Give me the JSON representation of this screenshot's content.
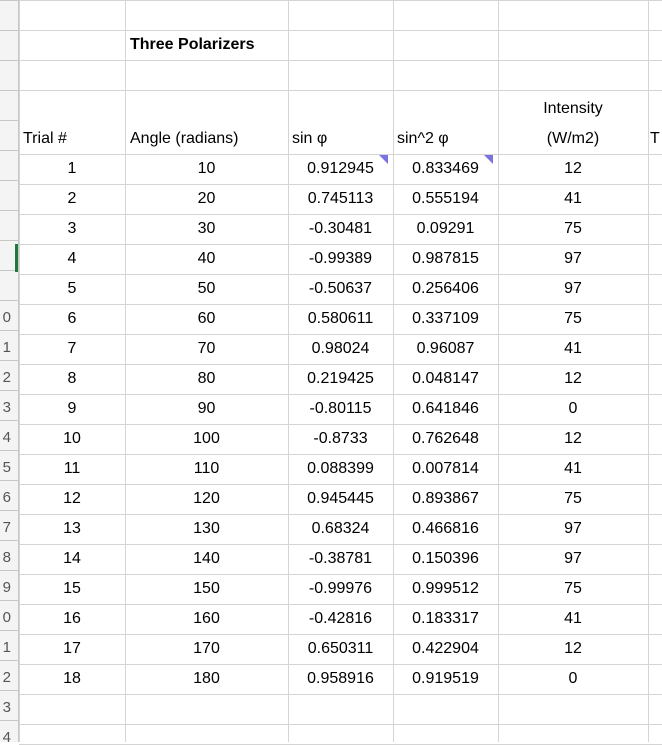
{
  "title": "Three Polarizers",
  "headers": {
    "trial": "Trial #",
    "angle": "Angle (radians)",
    "sin": "sin φ",
    "sin2": "sin^2 φ",
    "intensity_line1": "Intensity",
    "intensity_line2": "(W/m2)",
    "cut": "T"
  },
  "row_header_labels": [
    "",
    "",
    "",
    "",
    "",
    "",
    "",
    "",
    "",
    "0",
    "1",
    "2",
    "3",
    "4",
    "5",
    "6",
    "7",
    "8",
    "9",
    "0",
    "1",
    "2",
    "3",
    "4"
  ],
  "rows": [
    {
      "trial": "1",
      "angle": "10",
      "sin": "0.912945",
      "sin2": "0.833469",
      "intensity": "12"
    },
    {
      "trial": "2",
      "angle": "20",
      "sin": "0.745113",
      "sin2": "0.555194",
      "intensity": "41"
    },
    {
      "trial": "3",
      "angle": "30",
      "sin": "-0.30481",
      "sin2": "0.09291",
      "intensity": "75"
    },
    {
      "trial": "4",
      "angle": "40",
      "sin": "-0.99389",
      "sin2": "0.987815",
      "intensity": "97"
    },
    {
      "trial": "5",
      "angle": "50",
      "sin": "-0.50637",
      "sin2": "0.256406",
      "intensity": "97"
    },
    {
      "trial": "6",
      "angle": "60",
      "sin": "0.580611",
      "sin2": "0.337109",
      "intensity": "75"
    },
    {
      "trial": "7",
      "angle": "70",
      "sin": "0.98024",
      "sin2": "0.96087",
      "intensity": "41"
    },
    {
      "trial": "8",
      "angle": "80",
      "sin": "0.219425",
      "sin2": "0.048147",
      "intensity": "12"
    },
    {
      "trial": "9",
      "angle": "90",
      "sin": "-0.80115",
      "sin2": "0.641846",
      "intensity": "0"
    },
    {
      "trial": "10",
      "angle": "100",
      "sin": "-0.8733",
      "sin2": "0.762648",
      "intensity": "12"
    },
    {
      "trial": "11",
      "angle": "110",
      "sin": "0.088399",
      "sin2": "0.007814",
      "intensity": "41"
    },
    {
      "trial": "12",
      "angle": "120",
      "sin": "0.945445",
      "sin2": "0.893867",
      "intensity": "75"
    },
    {
      "trial": "13",
      "angle": "130",
      "sin": "0.68324",
      "sin2": "0.466816",
      "intensity": "97"
    },
    {
      "trial": "14",
      "angle": "140",
      "sin": "-0.38781",
      "sin2": "0.150396",
      "intensity": "97"
    },
    {
      "trial": "15",
      "angle": "150",
      "sin": "-0.99976",
      "sin2": "0.999512",
      "intensity": "75"
    },
    {
      "trial": "16",
      "angle": "160",
      "sin": "-0.42816",
      "sin2": "0.183317",
      "intensity": "41"
    },
    {
      "trial": "17",
      "angle": "170",
      "sin": "0.650311",
      "sin2": "0.422904",
      "intensity": "12"
    },
    {
      "trial": "18",
      "angle": "180",
      "sin": "0.958916",
      "sin2": "0.919519",
      "intensity": "0"
    }
  ],
  "colors": {
    "comment_marker": "#7b74e0",
    "active_row_marker": "#1e7b3a"
  }
}
